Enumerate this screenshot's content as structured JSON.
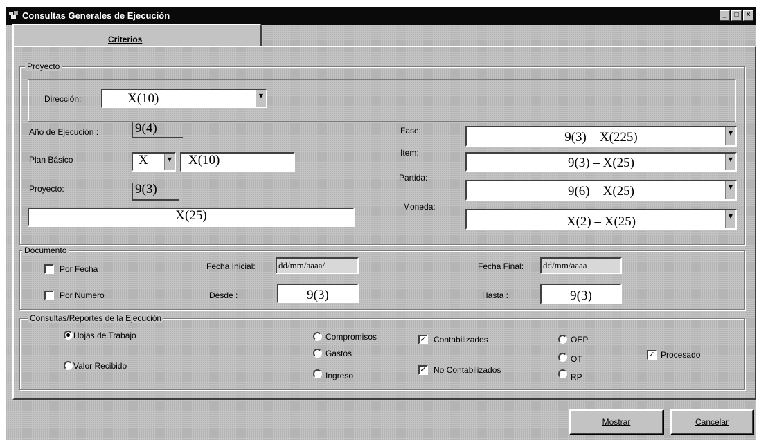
{
  "window": {
    "title": "Consultas Generales de Ejecución",
    "controls": [
      "_",
      "□",
      "×"
    ]
  },
  "tab": {
    "label": "Criterios"
  },
  "proyecto_group": {
    "label": "Proyecto",
    "direccion_label": "Dirección:",
    "direccion_value": "X(10)",
    "anio_label": "Año de Ejecución :",
    "anio_value": "9(4)",
    "plan_label": "Plan Básico",
    "plan_code": "X",
    "plan_value": "X(10)",
    "proyecto_label": "Proyecto:",
    "proyecto_value": "9(3)",
    "proyecto_desc": "X(25)",
    "fase_label": "Fase:",
    "fase_value": "9(3) – X(225)",
    "item_label": "Item:",
    "item_value": "9(3) – X(25)",
    "partida_label": "Partida:",
    "partida_value": "9(6) – X(25)",
    "moneda_label": "Moneda:",
    "moneda_value": "X(2) – X(25)"
  },
  "documento_group": {
    "label": "Documento",
    "por_fecha_label": "Por Fecha",
    "por_fecha_checked": false,
    "por_numero_label": "Por Numero",
    "por_numero_checked": false,
    "fecha_inicial_label": "Fecha Inicial:",
    "fecha_inicial_value": "dd/mm/aaaa/",
    "fecha_final_label": "Fecha Final:",
    "fecha_final_value": "dd/mm/aaaa",
    "desde_label": "Desde :",
    "desde_value": "9(3)",
    "hasta_label": "Hasta :",
    "hasta_value": "9(3)"
  },
  "consultas_group": {
    "label": "Consultas/Reportes de la Ejecución",
    "hojas_label": "Hojas de Trabajo",
    "valor_label": "Valor Recibido",
    "compromisos_label": "Compromisos",
    "gastos_label": "Gastos",
    "ingreso_label": "Ingreso",
    "contabilizados_label": "Contabilizados",
    "no_contabilizados_label": "No Contabilizados",
    "oep_label": "OEP",
    "ot_label": "OT",
    "rp_label": "RP",
    "procesado_label": "Procesado",
    "check_mark": "✓"
  },
  "buttons": {
    "mostrar": "Mostrar",
    "cancelar": "Cancelar"
  }
}
